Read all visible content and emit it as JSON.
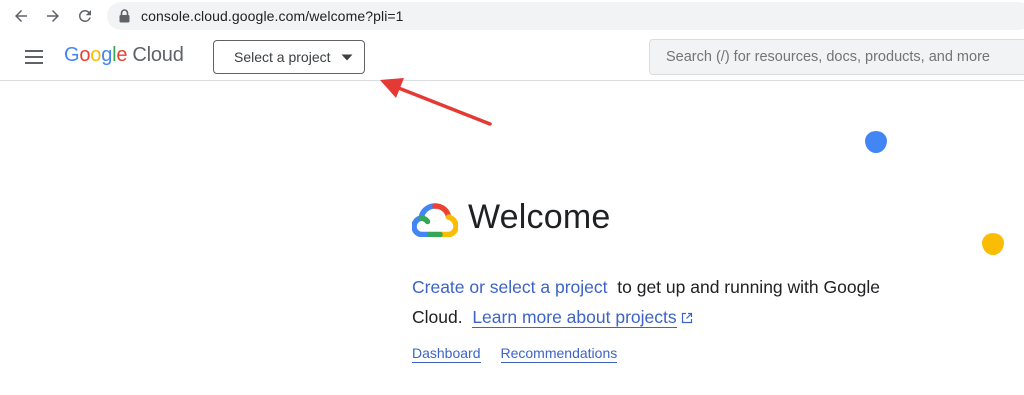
{
  "browser": {
    "url": "console.cloud.google.com/welcome?pli=1",
    "icons": [
      "back-arrow-icon",
      "forward-arrow-icon",
      "reload-icon",
      "lock-icon"
    ]
  },
  "header": {
    "logo": {
      "letters": [
        "G",
        "o",
        "o",
        "g",
        "l",
        "e"
      ],
      "product": "Cloud"
    },
    "project_select_label": "Select a project",
    "search_placeholder": "Search (/) for resources, docs, products, and more"
  },
  "welcome": {
    "title": "Welcome",
    "link_create": "Create or select a project",
    "text_part1": "to get up and running with Google Cloud.",
    "link_learn": "Learn more about projects",
    "quick_links": [
      "Dashboard",
      "Recommendations"
    ]
  },
  "colors": {
    "google_blue": "#4285f4",
    "google_red": "#ea4335",
    "google_yellow": "#fbbc04",
    "google_green": "#34a853",
    "link": "#3c63c5",
    "annotation_arrow": "#e53935"
  }
}
